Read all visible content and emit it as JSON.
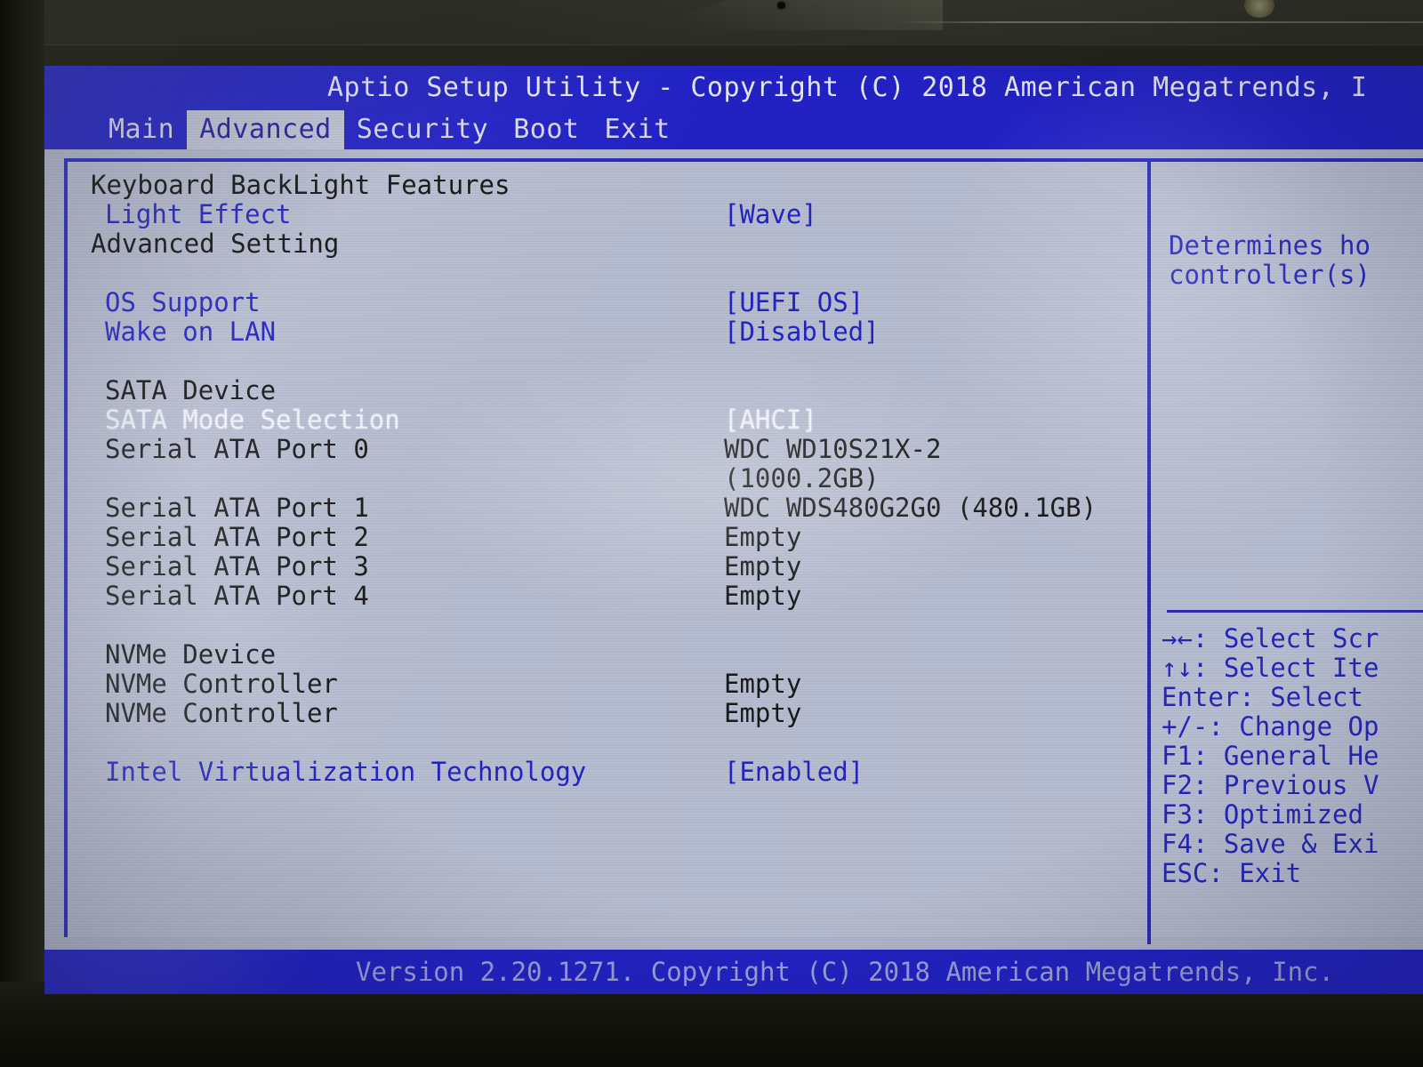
{
  "title_bar": {
    "text": "Aptio Setup Utility - Copyright (C) 2018 American Megatrends, I"
  },
  "menu": {
    "tabs": [
      {
        "label": "Main",
        "active": false
      },
      {
        "label": "Advanced",
        "active": true
      },
      {
        "label": "Security",
        "active": false
      },
      {
        "label": "Boot",
        "active": false
      },
      {
        "label": "Exit",
        "active": false
      }
    ]
  },
  "settings": {
    "rows": [
      {
        "label": "Keyboard BackLight Features",
        "value": "",
        "style": "head",
        "indent": false
      },
      {
        "label": "Light Effect",
        "value": "[Wave]",
        "style": "link",
        "indent": true
      },
      {
        "label": "Advanced Setting",
        "value": "",
        "style": "head",
        "indent": false
      },
      {
        "label": "",
        "value": "",
        "style": "gap",
        "indent": false
      },
      {
        "label": "OS Support",
        "value": "[UEFI OS]",
        "style": "link",
        "indent": true
      },
      {
        "label": "Wake on LAN",
        "value": "[Disabled]",
        "style": "link",
        "indent": true
      },
      {
        "label": "",
        "value": "",
        "style": "gap",
        "indent": false
      },
      {
        "label": "SATA Device",
        "value": "",
        "style": "head",
        "indent": true
      },
      {
        "label": "SATA Mode Selection",
        "value": "[AHCI]",
        "style": "sel",
        "indent": true
      },
      {
        "label": "Serial ATA Port 0",
        "value": "WDC WD10S21X-2",
        "style": "info",
        "indent": true
      },
      {
        "label": "",
        "value": "(1000.2GB)",
        "style": "info",
        "indent": true
      },
      {
        "label": "Serial ATA Port 1",
        "value": "WDC WDS480G2G0  (480.1GB)",
        "style": "info",
        "indent": true
      },
      {
        "label": "Serial ATA Port 2",
        "value": "Empty",
        "style": "info",
        "indent": true
      },
      {
        "label": "Serial ATA Port 3",
        "value": "Empty",
        "style": "info",
        "indent": true
      },
      {
        "label": "Serial ATA Port 4",
        "value": "Empty",
        "style": "info",
        "indent": true
      },
      {
        "label": "",
        "value": "",
        "style": "gap",
        "indent": false
      },
      {
        "label": "NVMe Device",
        "value": "",
        "style": "head",
        "indent": true
      },
      {
        "label": "NVMe Controller",
        "value": "Empty",
        "style": "info",
        "indent": true
      },
      {
        "label": "NVMe Controller",
        "value": "Empty",
        "style": "info",
        "indent": true
      },
      {
        "label": "",
        "value": "",
        "style": "gap",
        "indent": false
      },
      {
        "label": "Intel Virtualization Technology",
        "value": "[Enabled]",
        "style": "link",
        "indent": true
      }
    ]
  },
  "help": {
    "lines": [
      "Determines ho",
      "controller(s)"
    ]
  },
  "keys": {
    "lines": [
      "→←: Select Scr",
      "↑↓: Select Ite",
      "Enter: Select",
      "+/-: Change Op",
      "F1: General He",
      "F2: Previous V",
      "F3: Optimized ",
      "F4: Save & Exi",
      "ESC: Exit"
    ]
  },
  "footer": {
    "text": "Version 2.20.1271. Copyright (C) 2018 American Megatrends, Inc."
  },
  "colors": {
    "bios_blue": "#2222c8",
    "panel_bg": "#b9bfd3",
    "link_text": "#2424c4",
    "selected_text": "#f4f6ff",
    "static_text": "#1a1a1a"
  }
}
